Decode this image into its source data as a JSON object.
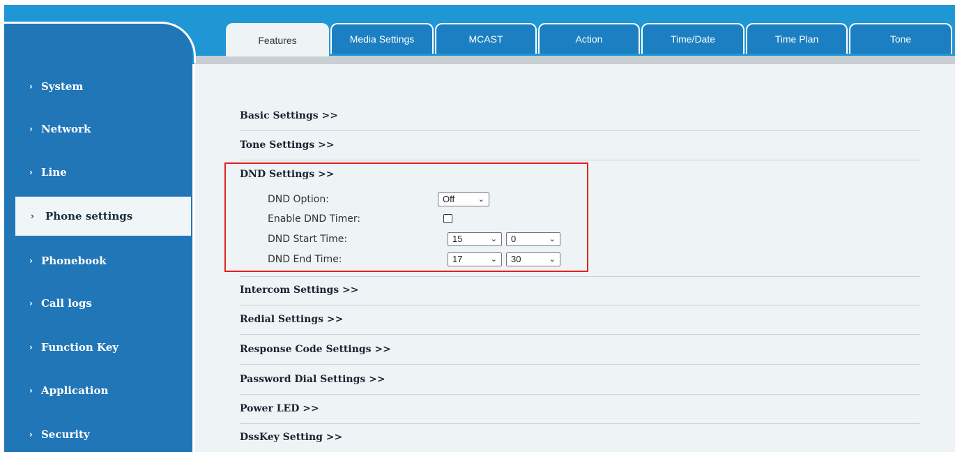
{
  "tabs": [
    {
      "label": "Features",
      "active": true
    },
    {
      "label": "Media Settings",
      "active": false
    },
    {
      "label": "MCAST",
      "active": false
    },
    {
      "label": "Action",
      "active": false
    },
    {
      "label": "Time/Date",
      "active": false
    },
    {
      "label": "Time Plan",
      "active": false
    },
    {
      "label": "Tone",
      "active": false
    }
  ],
  "sidebar": {
    "chevron_icon": "›",
    "items": [
      {
        "label": "System",
        "active": false
      },
      {
        "label": "Network",
        "active": false
      },
      {
        "label": "Line",
        "active": false
      },
      {
        "label": "Phone settings",
        "active": true
      },
      {
        "label": "Phonebook",
        "active": false
      },
      {
        "label": "Call logs",
        "active": false
      },
      {
        "label": "Function Key",
        "active": false
      },
      {
        "label": "Application",
        "active": false
      },
      {
        "label": "Security",
        "active": false
      }
    ]
  },
  "sections": [
    "Basic Settings >>",
    "Tone Settings >>",
    "DND Settings >>",
    "Intercom Settings >>",
    "Redial Settings >>",
    "Response Code Settings >>",
    "Password Dial Settings >>",
    "Power LED >>",
    "DssKey Setting >>"
  ],
  "dnd": {
    "option_label": "DND Option:",
    "option_value": "Off",
    "timer_label": "Enable DND Timer:",
    "timer_checked": false,
    "start_label": "DND Start Time:",
    "start_hour": "15",
    "start_minute": "0",
    "end_label": "DND End Time:",
    "end_hour": "17",
    "end_minute": "30"
  },
  "colors": {
    "brand_blue": "#1f97d4",
    "sidebar_blue": "#2176b8",
    "highlight_red": "#e0201f"
  },
  "icons": {
    "dropdown": "chevron-down-icon"
  }
}
